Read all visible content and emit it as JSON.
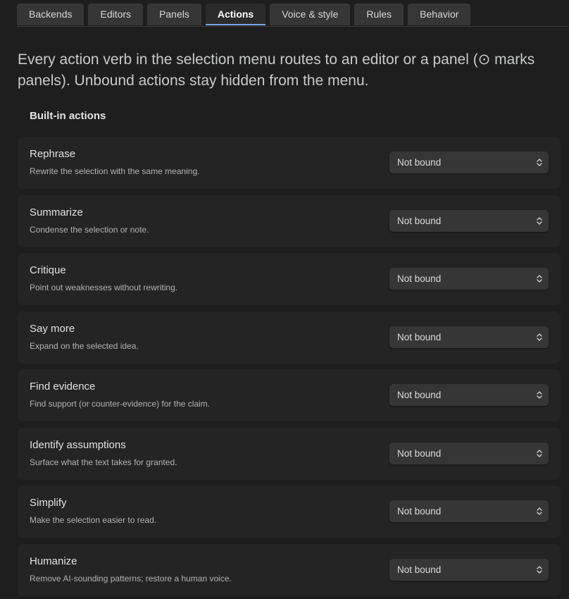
{
  "tabs": [
    {
      "label": "Backends"
    },
    {
      "label": "Editors"
    },
    {
      "label": "Panels"
    },
    {
      "label": "Actions"
    },
    {
      "label": "Voice & style"
    },
    {
      "label": "Rules"
    },
    {
      "label": "Behavior"
    }
  ],
  "active_tab": "Actions",
  "intro": "Every action verb in the selection menu routes to an editor or a panel (⊙ marks panels). Unbound actions stay hidden from the menu.",
  "section_title": "Built-in actions",
  "actions": [
    {
      "name": "Rephrase",
      "desc": "Rewrite the selection with the same meaning.",
      "binding": "Not bound"
    },
    {
      "name": "Summarize",
      "desc": "Condense the selection or note.",
      "binding": "Not bound"
    },
    {
      "name": "Critique",
      "desc": "Point out weaknesses without rewriting.",
      "binding": "Not bound"
    },
    {
      "name": "Say more",
      "desc": "Expand on the selected idea.",
      "binding": "Not bound"
    },
    {
      "name": "Find evidence",
      "desc": "Find support (or counter-evidence) for the claim.",
      "binding": "Not bound"
    },
    {
      "name": "Identify assumptions",
      "desc": "Surface what the text takes for granted.",
      "binding": "Not bound"
    },
    {
      "name": "Simplify",
      "desc": "Make the selection easier to read.",
      "binding": "Not bound"
    },
    {
      "name": "Humanize",
      "desc": "Remove AI-sounding patterns; restore a human voice.",
      "binding": "Not bound"
    }
  ],
  "icons": {
    "select": "chevron-up-down-icon"
  },
  "colors": {
    "accent": "#7aa9e8",
    "background": "#1e1e1e"
  }
}
